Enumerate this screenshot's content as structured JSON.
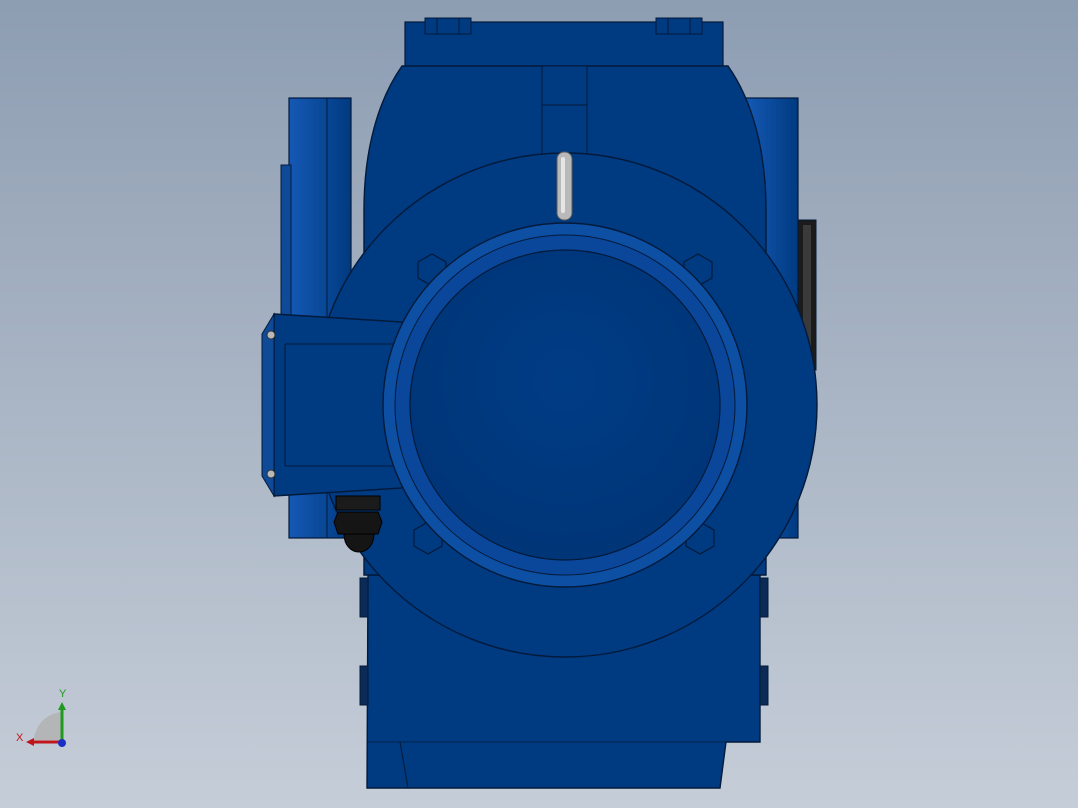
{
  "viewport": {
    "background_top": "#8d9db2",
    "background_bottom": "#c5cdd8"
  },
  "model": {
    "body_color": "#003a80",
    "highlight_color": "#0d4fa3",
    "edge_color": "#031a3a",
    "cable_gland_color": "#151515",
    "breather_color": "#b9b9b9"
  },
  "triad": {
    "x_label": "X",
    "y_label": "Y",
    "x_color": "#c0161b",
    "y_color": "#1f9a1f",
    "z_color": "#1a2fc4"
  }
}
